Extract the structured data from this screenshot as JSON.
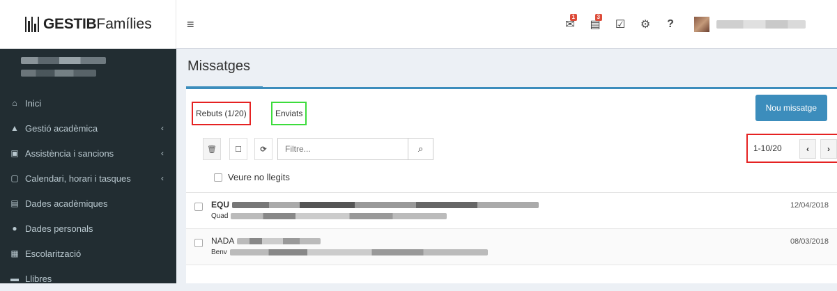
{
  "header": {
    "brand_bold": "GESTIB",
    "brand_light": "Famílies",
    "menu_icon": "hamburger-icon",
    "icons": [
      {
        "name": "messages-icon",
        "glyph": "✉",
        "badge": "1"
      },
      {
        "name": "notices-icon",
        "glyph": "🗎",
        "badge": "3"
      },
      {
        "name": "tasks-icon",
        "glyph": "☑",
        "badge": ""
      },
      {
        "name": "settings-icon",
        "glyph": "⚙",
        "badge": ""
      },
      {
        "name": "help-icon",
        "glyph": "?",
        "badge": ""
      }
    ]
  },
  "sidebar": {
    "items": [
      {
        "label": "Inici",
        "icon": "home-icon",
        "glyph": "⌂",
        "caret": ""
      },
      {
        "label": "Gestió acadèmica",
        "icon": "graduation-icon",
        "glyph": "🎓",
        "caret": "‹"
      },
      {
        "label": "Assistència i sancions",
        "icon": "calendar-check-icon",
        "glyph": "▣",
        "caret": "‹"
      },
      {
        "label": "Calendari, horari i tasques",
        "icon": "calendar-icon",
        "glyph": "▢",
        "caret": "‹"
      },
      {
        "label": "Dades acadèmiques",
        "icon": "archive-icon",
        "glyph": "▤",
        "caret": ""
      },
      {
        "label": "Dades personals",
        "icon": "user-icon",
        "glyph": "●",
        "caret": ""
      },
      {
        "label": "Escolarització",
        "icon": "building-icon",
        "glyph": "▦",
        "caret": ""
      },
      {
        "label": "Llibres",
        "icon": "book-icon",
        "glyph": "▬",
        "caret": ""
      }
    ]
  },
  "page": {
    "title": "Missatges"
  },
  "mailbox": {
    "tab_received": "Rebuts (1/20)",
    "tab_sent": "Enviats",
    "new_message": "Nou missatge",
    "filter_placeholder": "Filtre...",
    "pager_text": "1-10/20",
    "show_unread": "Veure no llegits",
    "messages": [
      {
        "from": "EQU",
        "subject": "Quad",
        "date": "12/04/2018",
        "unread": true
      },
      {
        "from": "NADA",
        "subject": "Benv",
        "date": "08/03/2018",
        "unread": false
      }
    ]
  }
}
